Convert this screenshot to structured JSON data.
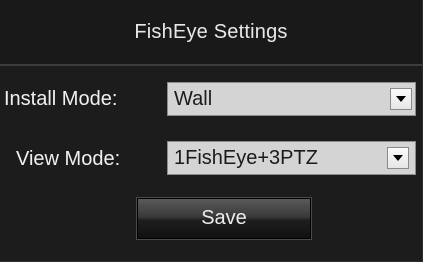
{
  "panel": {
    "title": "FishEye Settings"
  },
  "install_mode": {
    "label": "Install Mode:",
    "value": "Wall"
  },
  "view_mode": {
    "label": "View Mode:",
    "value": "1FishEye+3PTZ"
  },
  "actions": {
    "save_label": "Save"
  },
  "icons": {
    "dropdown": "chevron-down-icon"
  },
  "colors": {
    "panel_background": "#1c1c1c",
    "select_background": "#d4d4d4",
    "label_text": "#f0f0f0"
  }
}
